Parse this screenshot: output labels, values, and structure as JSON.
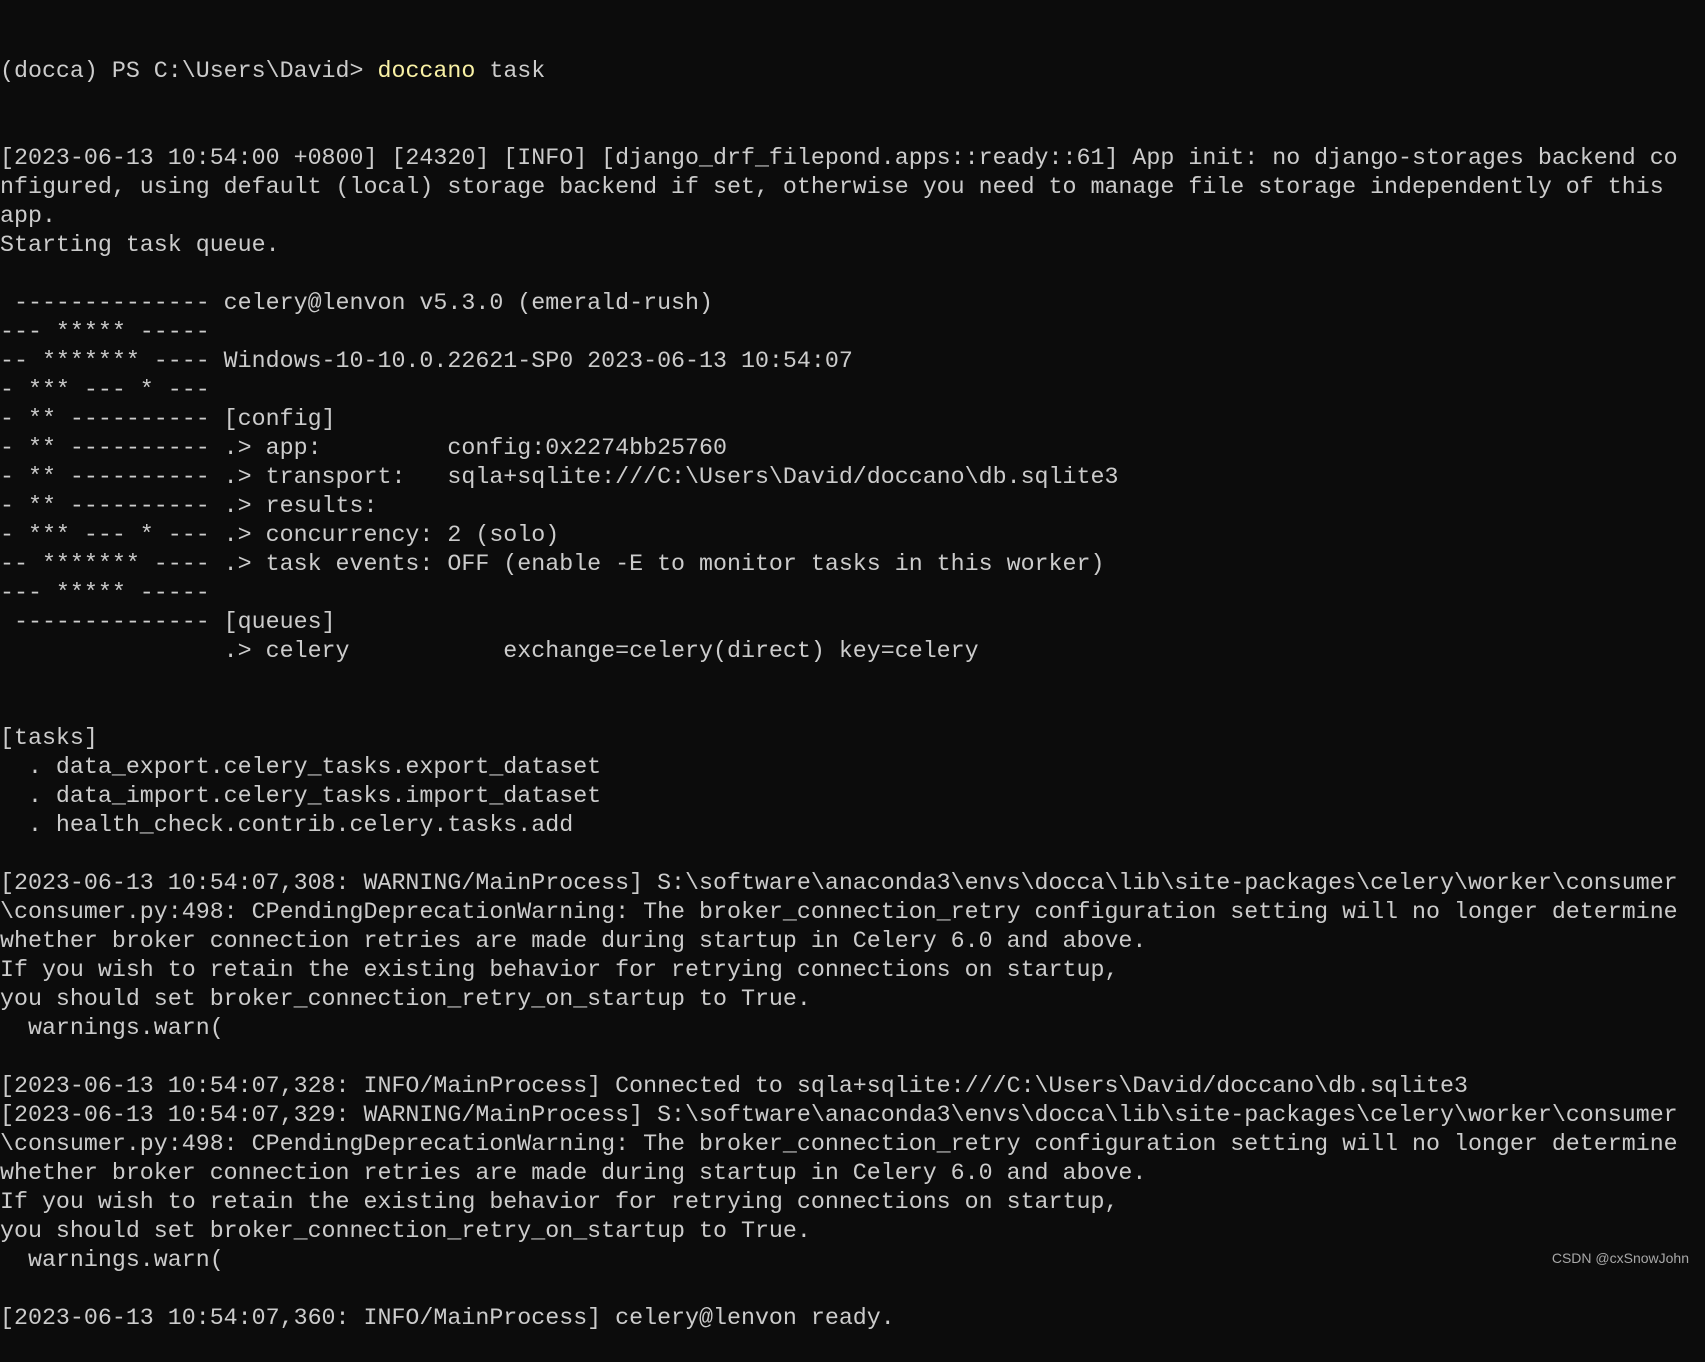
{
  "terminal": {
    "background": "#0c0c0c",
    "foreground": "#cccccc",
    "command_color": "#f9f1a5",
    "prompt": {
      "prefix": "(docca) PS C:\\Users\\David> ",
      "command": "doccano",
      "args": " task"
    },
    "lines": [
      "[2023-06-13 10:54:00 +0800] [24320] [INFO] [django_drf_filepond.apps::ready::61] App init: no django-storages backend co",
      "nfigured, using default (local) storage backend if set, otherwise you need to manage file storage independently of this",
      "app.",
      "Starting task queue.",
      "",
      " -------------- celery@lenvon v5.3.0 (emerald-rush)",
      "--- ***** -----",
      "-- ******* ---- Windows-10-10.0.22621-SP0 2023-06-13 10:54:07",
      "- *** --- * ---",
      "- ** ---------- [config]",
      "- ** ---------- .> app:         config:0x2274bb25760",
      "- ** ---------- .> transport:   sqla+sqlite:///C:\\Users\\David/doccano\\db.sqlite3",
      "- ** ---------- .> results:",
      "- *** --- * --- .> concurrency: 2 (solo)",
      "-- ******* ---- .> task events: OFF (enable -E to monitor tasks in this worker)",
      "--- ***** -----",
      " -------------- [queues]",
      "                .> celery           exchange=celery(direct) key=celery",
      "",
      "",
      "[tasks]",
      "  . data_export.celery_tasks.export_dataset",
      "  . data_import.celery_tasks.import_dataset",
      "  . health_check.contrib.celery.tasks.add",
      "",
      "[2023-06-13 10:54:07,308: WARNING/MainProcess] S:\\software\\anaconda3\\envs\\docca\\lib\\site-packages\\celery\\worker\\consumer",
      "\\consumer.py:498: CPendingDeprecationWarning: The broker_connection_retry configuration setting will no longer determine",
      "whether broker connection retries are made during startup in Celery 6.0 and above.",
      "If you wish to retain the existing behavior for retrying connections on startup,",
      "you should set broker_connection_retry_on_startup to True.",
      "  warnings.warn(",
      "",
      "[2023-06-13 10:54:07,328: INFO/MainProcess] Connected to sqla+sqlite:///C:\\Users\\David/doccano\\db.sqlite3",
      "[2023-06-13 10:54:07,329: WARNING/MainProcess] S:\\software\\anaconda3\\envs\\docca\\lib\\site-packages\\celery\\worker\\consumer",
      "\\consumer.py:498: CPendingDeprecationWarning: The broker_connection_retry configuration setting will no longer determine",
      "whether broker connection retries are made during startup in Celery 6.0 and above.",
      "If you wish to retain the existing behavior for retrying connections on startup,",
      "you should set broker_connection_retry_on_startup to True.",
      "  warnings.warn(",
      "",
      "[2023-06-13 10:54:07,360: INFO/MainProcess] celery@lenvon ready."
    ]
  },
  "watermark": "CSDN @cxSnowJohn"
}
